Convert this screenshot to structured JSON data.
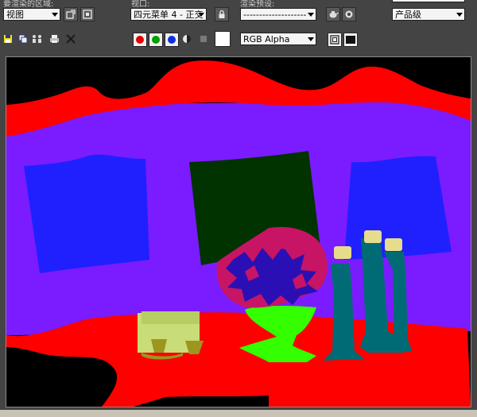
{
  "labels": {
    "area": "要渲染的区域:",
    "viewport": "视口:",
    "preset": "渲染预设:"
  },
  "area_select": "视图",
  "viewport_select": "四元菜单 4 - 正交",
  "preset_select": "--------------------",
  "quality_select": "产品级",
  "channel_select": "RGB Alpha",
  "icons": {
    "area_btn1": "region-crop-icon",
    "area_btn2": "auto-region-icon",
    "lock": "lock-icon",
    "render_setup": "render-setup-icon",
    "render": "render-teapot-icon",
    "save": "save-image-icon",
    "copy": "copy-image-icon",
    "clone": "clone-frame-window-icon",
    "print": "print-image-icon",
    "clear": "clear-icon",
    "red": "red-channel-icon",
    "green": "green-channel-icon",
    "blue": "blue-channel-icon",
    "alpha": "alpha-channel-icon",
    "mono": "monochrome-icon",
    "swatch": "color-swatch",
    "toggle_ui": "toggle-ui-overlay-icon",
    "toggle_view": "toggle-display-icon"
  },
  "colors": {
    "background": "#000000",
    "curtain": "#ff0000",
    "wall": "#7a1cff",
    "frame_left": "#2020ff",
    "frame_center": "#003300",
    "frame_right": "#2020ff",
    "table": "#ff0000",
    "vase": "#33ff00",
    "flowers_a": "#c81464",
    "flowers_b": "#2a10b4",
    "candlestick": "#006b75",
    "candle": "#e6dc8c",
    "book": "#c8dc78",
    "cups": "#9c961e"
  }
}
